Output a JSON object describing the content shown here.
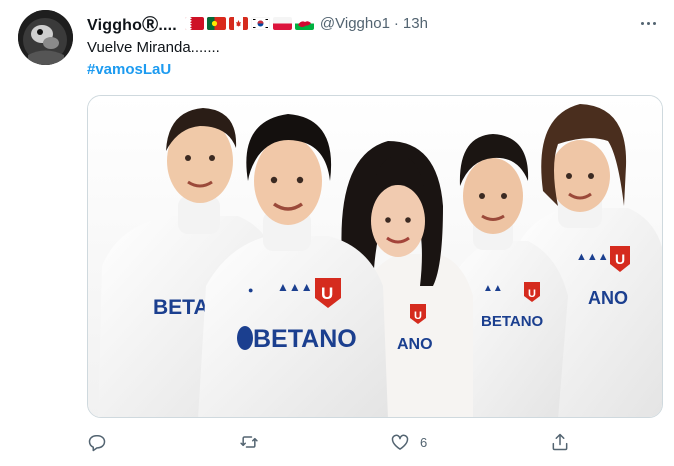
{
  "tweet": {
    "display_name": "VigghoⓇ....",
    "handle": "@Viggho1",
    "separator": "·",
    "time": "13h",
    "text": "Vuelve Miranda.......",
    "hashtag": "#vamosLaU",
    "flags": [
      "bahrain-flag",
      "portugal-flag",
      "canada-flag",
      "south-korea-flag",
      "poland-flag",
      "wales-flag"
    ]
  },
  "media": {
    "description_icons": [
      "adidas-logo",
      "universidad-de-chile-crest",
      "betano-sponsor"
    ],
    "shirt_texts": [
      "BETANO",
      "BETANO",
      "BETANO",
      "BETANO",
      "BETANO"
    ],
    "crest_letter": "U"
  },
  "actions": {
    "reply_count": "",
    "retweet_count": "",
    "like_count": "6",
    "share_count": ""
  },
  "colors": {
    "accent": "#1d9bf0",
    "muted": "#536471",
    "crest_red": "#d52b1e",
    "betano_blue": "#1b3f8f"
  }
}
